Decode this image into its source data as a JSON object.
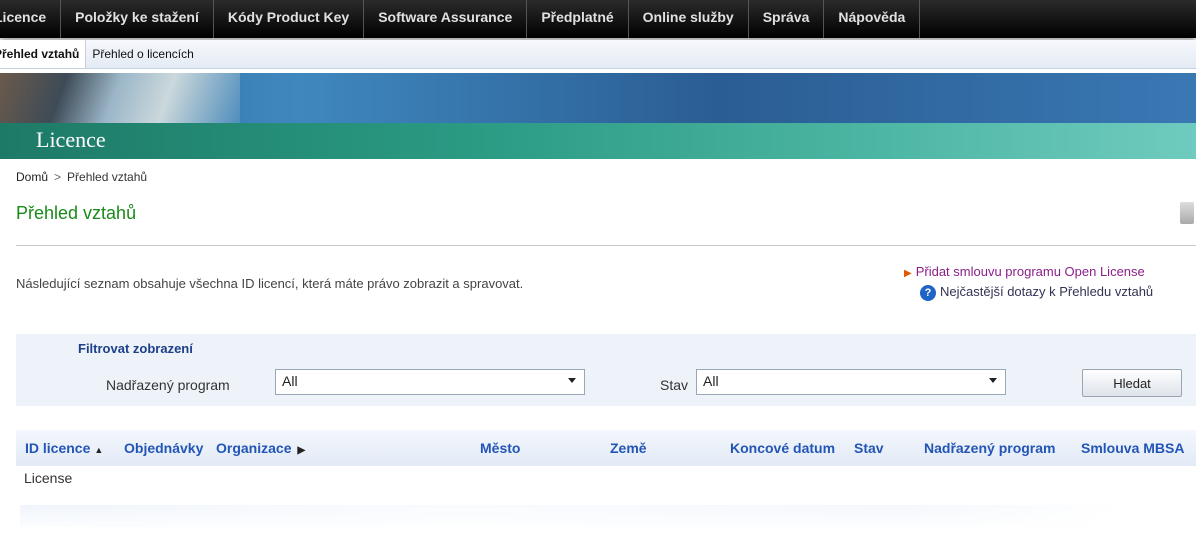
{
  "topnav": {
    "items": [
      "Licence",
      "Položky ke stažení",
      "Kódy Product Key",
      "Software Assurance",
      "Předplatné",
      "Online služby",
      "Správa",
      "Nápověda"
    ]
  },
  "subnav": {
    "tabs": [
      "Přehled vztahů",
      "Přehled o licencích"
    ],
    "active": "Přehled vztahů"
  },
  "banner": {
    "title": "Licence"
  },
  "breadcrumb": {
    "home": "Domů",
    "separator": ">",
    "current": "Přehled vztahů"
  },
  "page": {
    "title": "Přehled vztahů",
    "intro": "Následující seznam obsahuje všechna ID licencí, která máte právo zobrazit a spravovat."
  },
  "side_links": {
    "add_open_license": "Přidat smlouvu programu Open License",
    "faq": "Nejčastější dotazy k Přehledu vztahů"
  },
  "filter": {
    "title": "Filtrovat zobrazení",
    "parent_program_label": "Nadřazený program",
    "parent_program_value": "All",
    "status_label": "Stav",
    "status_value": "All",
    "search_button": "Hledat"
  },
  "table": {
    "columns": [
      "ID licence",
      "Objednávky",
      "Organizace",
      "Město",
      "Země",
      "Koncové datum",
      "Stav",
      "Nadřazený program",
      "Smlouva MBSA"
    ],
    "rows": [
      [
        "License"
      ]
    ]
  },
  "colors": {
    "topnav_bg": "#000000",
    "title_green": "#1a8a1a",
    "link_blue": "#2255b5",
    "link_purple": "#8a1f8a"
  }
}
